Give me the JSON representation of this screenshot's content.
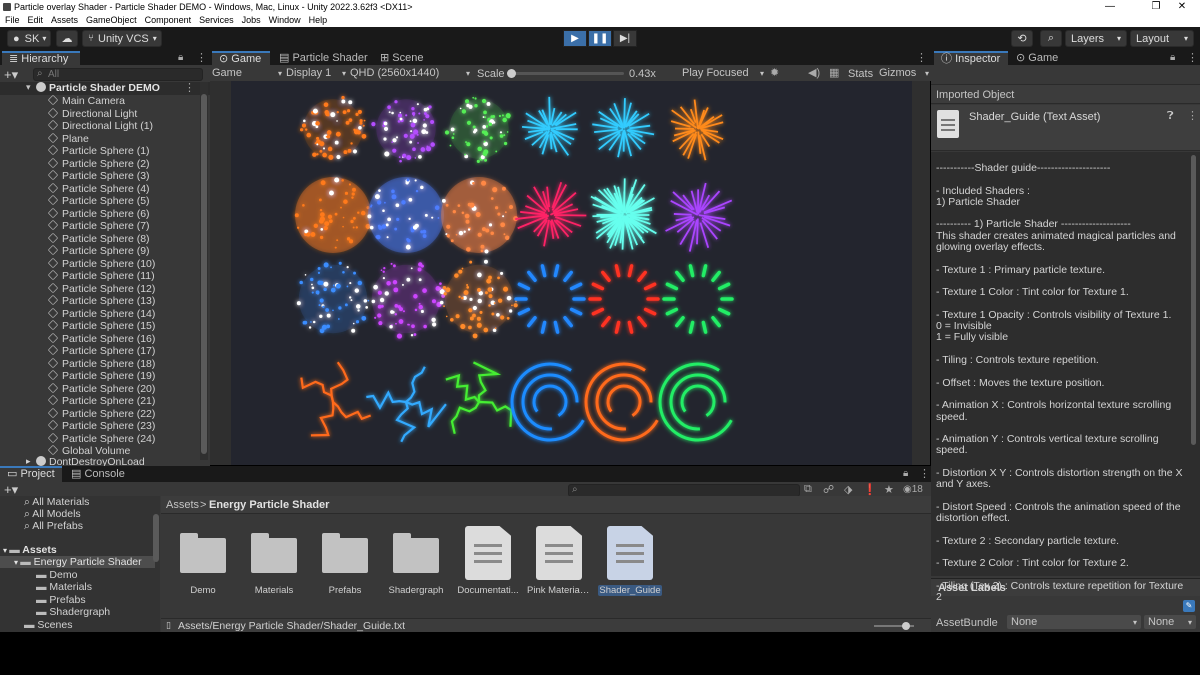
{
  "window": {
    "title": "Particle overlay Shader - Particle Shader DEMO - Windows, Mac, Linux - Unity 2022.3.62f3 <DX11>",
    "controls": [
      "—",
      "❐",
      "✕"
    ]
  },
  "menu": [
    "File",
    "Edit",
    "Assets",
    "GameObject",
    "Component",
    "Services",
    "Jobs",
    "Window",
    "Help"
  ],
  "toolbar": {
    "account": "SK",
    "vcs": "Unity VCS",
    "layers": "Layers",
    "layout": "Layout"
  },
  "hierarchy": {
    "tab": "Hierarchy",
    "search_placeholder": "All",
    "scene": "Particle Shader DEMO",
    "items": [
      "Main Camera",
      "Directional Light",
      "Directional Light (1)",
      "Plane",
      "Particle Sphere (1)",
      "Particle Sphere (2)",
      "Particle Sphere (3)",
      "Particle Sphere (4)",
      "Particle Sphere (5)",
      "Particle Sphere (6)",
      "Particle Sphere (7)",
      "Particle Sphere (8)",
      "Particle Sphere (9)",
      "Particle Sphere (10)",
      "Particle Sphere (11)",
      "Particle Sphere (12)",
      "Particle Sphere (13)",
      "Particle Sphere (14)",
      "Particle Sphere (15)",
      "Particle Sphere (16)",
      "Particle Sphere (17)",
      "Particle Sphere (18)",
      "Particle Sphere (19)",
      "Particle Sphere (20)",
      "Particle Sphere (21)",
      "Particle Sphere (22)",
      "Particle Sphere (23)",
      "Particle Sphere (24)",
      "Global Volume"
    ],
    "dont_destroy": "DontDestroyOnLoad"
  },
  "center_tabs": [
    "Game",
    "Particle Shader",
    "Scene"
  ],
  "game_bar": {
    "mode": "Game",
    "display": "Display 1",
    "resolution": "QHD (2560x1440)",
    "scale_label": "Scale",
    "scale_value": "0.43x",
    "play_focused": "Play Focused",
    "stats": "Stats",
    "gizmos": "Gizmos"
  },
  "project": {
    "tabs": [
      "Project",
      "Console"
    ],
    "favorites": [
      "All Materials",
      "All Models",
      "All Prefabs"
    ],
    "assets_root": "Assets",
    "tree": [
      "Energy Particle Shader",
      "Demo",
      "Materials",
      "Prefabs",
      "Shadergraph"
    ],
    "scenes": "Scenes",
    "breadcrumb_root": "Assets",
    "breadcrumb_sep": ">",
    "breadcrumb_folder": "Energy Particle Shader",
    "hidden_count": "18",
    "assets": [
      {
        "label": "Demo",
        "kind": "folder"
      },
      {
        "label": "Materials",
        "kind": "folder"
      },
      {
        "label": "Prefabs",
        "kind": "folder"
      },
      {
        "label": "Shadergraph",
        "kind": "folder"
      },
      {
        "label": "Documentati...",
        "kind": "doc"
      },
      {
        "label": "Pink Material I...",
        "kind": "doc"
      },
      {
        "label": "Shader_Guide",
        "kind": "doc"
      }
    ],
    "status_path": "Assets/Energy Particle Shader/Shader_Guide.txt"
  },
  "inspector": {
    "tabs": [
      "Inspector",
      "Game"
    ],
    "imported_object": "Imported Object",
    "asset_name": "Shader_Guide (Text Asset)",
    "text": "-----------Shader guide---------------------\n\n- Included Shaders :\n1) Particle Shader\n\n---------- 1) Particle Shader --------------------\nThis shader creates animated magical particles and glowing overlay effects.\n\n- Texture 1 : Primary particle texture.\n\n- Texture 1 Color : Tint color for Texture 1.\n\n- Texture 1 Opacity : Controls visibility of Texture 1.\n0 = Invisible\n1 = Fully visible\n\n- Tiling : Controls texture repetition.\n\n- Offset : Moves the texture position.\n\n- Animation X : Controls horizontal texture scrolling speed.\n\n- Animation Y : Controls vertical texture scrolling speed.\n\n- Distortion X Y : Controls distortion strength on the X and Y axes.\n\n- Distort Speed : Controls the animation speed of the distortion effect.\n\n- Texture 2 : Secondary particle texture.\n\n- Texture 2 Color : Tint color for Texture 2.\n\n- Tiling (Tex 2) : Controls texture repetition for Texture 2",
    "asset_labels": "Asset Labels",
    "asset_bundle_label": "AssetBundle",
    "bundle_value": "None",
    "variant_value": "None"
  },
  "game_grid": {
    "colors": [
      "#ff7a1a",
      "#b44dff",
      "#55ee55",
      "#33ccff",
      "#33ccff",
      "#ff8a1a",
      "#ff7a1a",
      "#4d7dff",
      "#ff8844",
      "#ff2266",
      "#66ffee",
      "#aa44ff",
      "#3a8dff",
      "#cc44ff",
      "#ff8a2a",
      "#2288ff",
      "#ff3322",
      "#22ee66",
      "#ff6a1a",
      "#33aaff",
      "#44ee33",
      "#1e8cff",
      "#ff6a1a",
      "#22ee66"
    ]
  }
}
